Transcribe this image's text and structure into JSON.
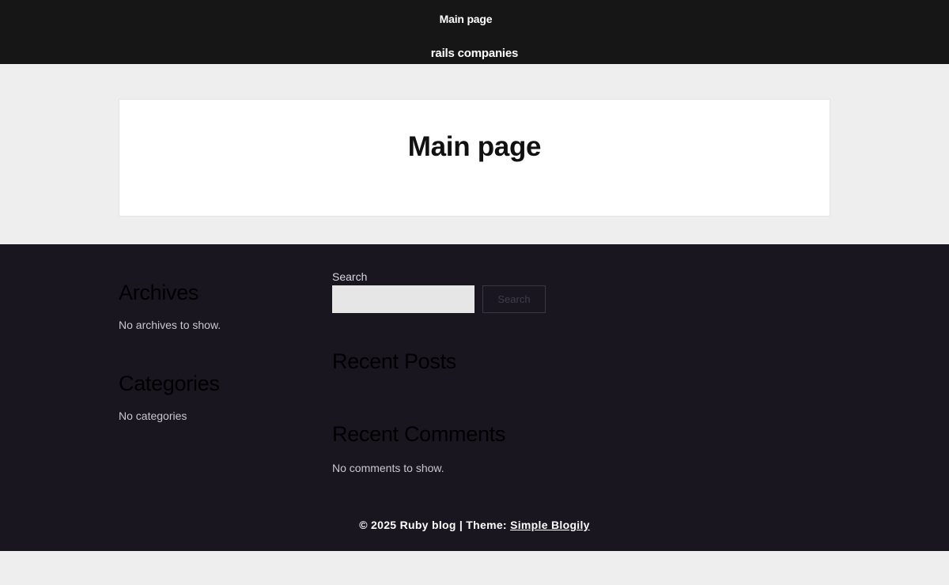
{
  "header": {
    "nav_link": "Main page",
    "site_title": "rails companies"
  },
  "main": {
    "page_title": "Main page"
  },
  "footer": {
    "archives": {
      "title": "Archives",
      "empty_text": "No archives to show."
    },
    "categories": {
      "title": "Categories",
      "empty_text": "No categories"
    },
    "search": {
      "label": "Search",
      "value": "",
      "placeholder": "",
      "button_label": "Search"
    },
    "recent_posts": {
      "title": "Recent Posts"
    },
    "recent_comments": {
      "title": "Recent Comments",
      "empty_text": "No comments to show."
    },
    "credits": {
      "copyright": "© 2025 Ruby blog | Theme:",
      "theme_link": "Simple Blogily"
    }
  },
  "colors": {
    "header_bg": "#161616",
    "page_bg": "#eeeeee",
    "card_bg": "#ffffff",
    "footer_bg": "#191620",
    "footer_text": "#c9c8cc"
  }
}
